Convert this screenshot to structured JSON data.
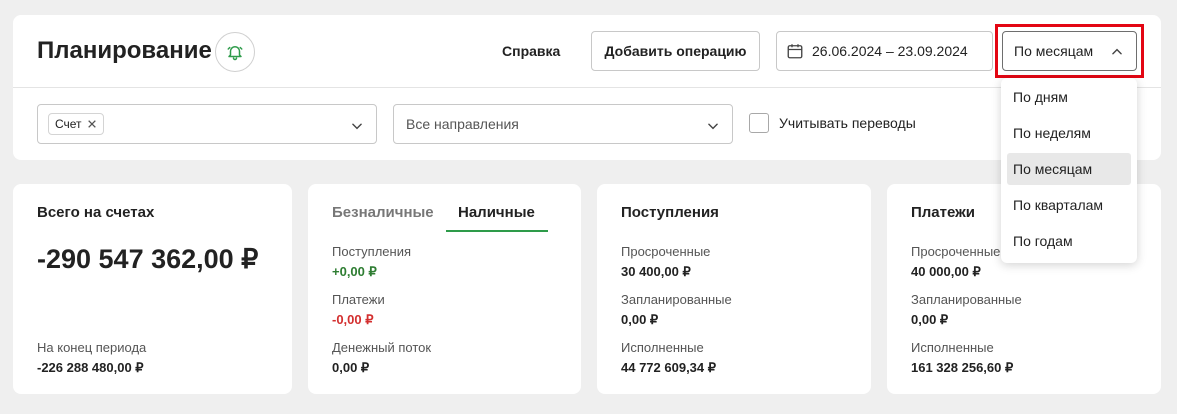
{
  "header": {
    "title": "Планирование",
    "help_label": "Справка",
    "add_label": "Добавить операцию",
    "date_range": "26.06.2024 – 23.09.2024",
    "period_value": "По месяцам"
  },
  "filters": {
    "account_chip": "Счет",
    "direction_placeholder": "Все направления",
    "transfers_label": "Учитывать переводы"
  },
  "period_options": [
    {
      "label": "По дням"
    },
    {
      "label": "По неделям"
    },
    {
      "label": "По месяцам",
      "selected": true
    },
    {
      "label": "По кварталам"
    },
    {
      "label": "По годам"
    }
  ],
  "totals": {
    "title": "Всего на счетах",
    "value": "-290 547 362,00 ₽",
    "end_label": "На конец периода",
    "end_value": "-226 288 480,00 ₽"
  },
  "cash": {
    "tab_cashless": "Безналичные",
    "tab_cash": "Наличные",
    "income_label": "Поступления",
    "income_value": "+0,00 ₽",
    "payments_label": "Платежи",
    "payments_value": "-0,00 ₽",
    "flow_label": "Денежный поток",
    "flow_value": "0,00 ₽"
  },
  "income": {
    "title": "Поступления",
    "overdue_label": "Просроченные",
    "overdue_value": "30 400,00 ₽",
    "planned_label": "Запланированные",
    "planned_value": "0,00 ₽",
    "done_label": "Исполненные",
    "done_value": "44 772 609,34 ₽"
  },
  "payments": {
    "title": "Платежи",
    "overdue_label": "Просроченные",
    "overdue_value": "40 000,00 ₽",
    "planned_label": "Запланированные",
    "planned_value": "0,00 ₽",
    "done_label": "Исполненные",
    "done_value": "161 328 256,60 ₽"
  },
  "colors": {
    "accent_green": "#2e9b4a",
    "highlight_red": "#e30613"
  }
}
